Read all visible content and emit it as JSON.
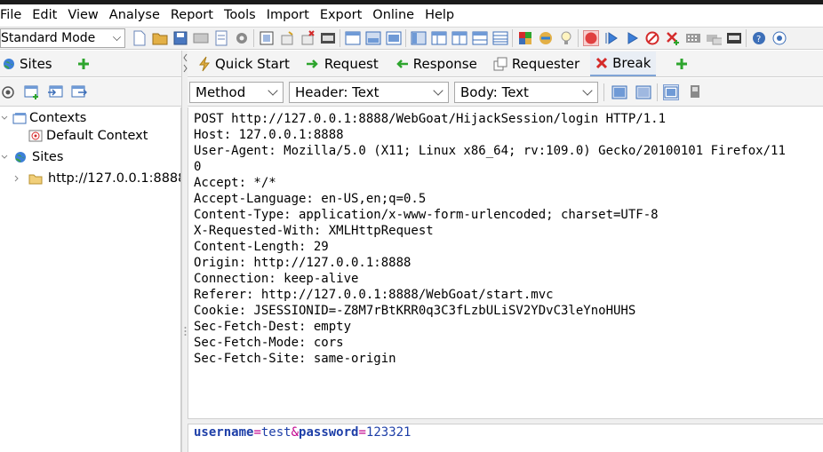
{
  "menu": [
    "File",
    "Edit",
    "View",
    "Analyse",
    "Report",
    "Tools",
    "Import",
    "Export",
    "Online",
    "Help"
  ],
  "toolbar": {
    "mode": "Standard Mode",
    "icons": [
      "new-session-icon",
      "open-session-icon",
      "save-session-icon",
      "snapshot-icon",
      "session-properties-icon",
      "options-icon",
      "context-icon",
      "add-break-icon",
      "remove-break-icon",
      "layout-full-icon",
      "layout-left-icon",
      "layout-tabs-icon",
      "layout-bottom-icon",
      "layout-panel-1-icon",
      "layout-panel-2-icon",
      "layout-panel-3-icon",
      "layout-panel-4-icon",
      "layout-panel-5-icon",
      "addons-icon",
      "scan-policy-icon",
      "hud-icon",
      "break-all-icon",
      "step-icon",
      "continue-icon",
      "drop-icon",
      "add-breakpoint-icon",
      "fuzzer-icon",
      "plugins-icon",
      "terminal-icon",
      "help-icon",
      "support-icon"
    ]
  },
  "left_panel": {
    "tab_label": "Sites",
    "tree": {
      "contexts": "Contexts",
      "default_context": "Default Context",
      "sites": "Sites",
      "site_url": "http://127.0.0.1:8888"
    }
  },
  "right_panel": {
    "tabs": [
      "Quick Start",
      "Request",
      "Response",
      "Requester",
      "Break"
    ],
    "active_tab": "Break",
    "combos": {
      "method": "Method",
      "header": "Header: Text",
      "body": "Body: Text"
    },
    "request_header_lines": [
      "POST http://127.0.0.1:8888/WebGoat/HijackSession/login HTTP/1.1",
      "Host: 127.0.0.1:8888",
      "User-Agent: Mozilla/5.0 (X11; Linux x86_64; rv:109.0) Gecko/20100101 Firefox/11",
      "0",
      "Accept: */*",
      "Accept-Language: en-US,en;q=0.5",
      "Content-Type: application/x-www-form-urlencoded; charset=UTF-8",
      "X-Requested-With: XMLHttpRequest",
      "Content-Length: 29",
      "Origin: http://127.0.0.1:8888",
      "Connection: keep-alive",
      "Referer: http://127.0.0.1:8888/WebGoat/start.mvc",
      "Cookie: JSESSIONID=-Z8M7rBtKRR0q3C3fLzbULiSV2YDvC3leYnoHUHS",
      "Sec-Fetch-Dest: empty",
      "Sec-Fetch-Mode: cors",
      "Sec-Fetch-Site: same-origin"
    ],
    "request_body": {
      "k1": "username",
      "eq1": "=",
      "v1": "test",
      "amp": "&",
      "k2": "password",
      "eq2": "=",
      "v2": "123321"
    }
  },
  "colors": {
    "accent_tab": "#7fa4d6",
    "body_key": "#1e3fa8",
    "body_operator": "#c0008c",
    "break_red": "#d42a2a",
    "add_green": "#2ea52e"
  }
}
